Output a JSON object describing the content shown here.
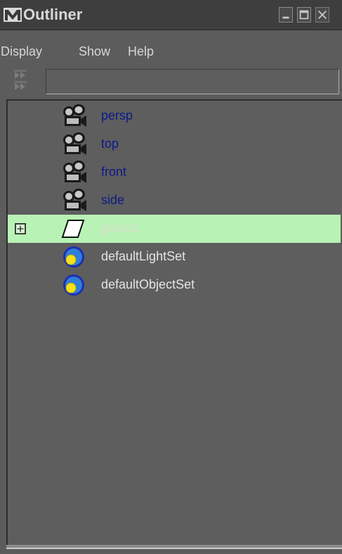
{
  "window": {
    "title": "Outliner",
    "controls": [
      "minimize",
      "maximize",
      "close"
    ]
  },
  "menubar": {
    "items": [
      "Display",
      "Show",
      "Help"
    ]
  },
  "toolbar": {
    "filter_value": ""
  },
  "outliner": {
    "items": [
      {
        "label": "persp",
        "icon": "camera-icon",
        "type": "camera"
      },
      {
        "label": "top",
        "icon": "camera-icon",
        "type": "camera"
      },
      {
        "label": "front",
        "icon": "camera-icon",
        "type": "camera"
      },
      {
        "label": "side",
        "icon": "camera-icon",
        "type": "camera"
      },
      {
        "label": "group1",
        "icon": "group-transform-icon",
        "type": "group",
        "selected": true,
        "expandable": true
      },
      {
        "label": "defaultLightSet",
        "icon": "set-icon",
        "type": "set"
      },
      {
        "label": "defaultObjectSet",
        "icon": "set-icon",
        "type": "set"
      }
    ]
  },
  "colors": {
    "background": "#5c5c5c",
    "titlebar": "#3e3e3e",
    "selected_row": "#b8f3b5",
    "camera_label": "#0b1a86",
    "set_label": "#e4e4e4"
  }
}
